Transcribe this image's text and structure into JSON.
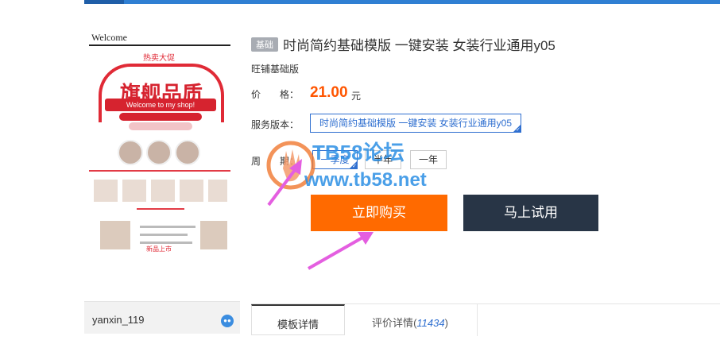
{
  "product": {
    "badge": "基础",
    "title": "时尚简约基础模版 一键安装 女装行业通用y05",
    "shop": "旺铺基础版",
    "price_label": "价　　格：",
    "price": "21.00",
    "currency": "元",
    "version_label": "服务版本：",
    "version_option": "时尚简约基础模版 一键安装 女装行业通用y05",
    "period_label": "周　　期：",
    "periods": [
      "一季度",
      "半年",
      "一年"
    ],
    "buy_label": "立即购买",
    "trial_label": "马上试用"
  },
  "thumbnail": {
    "welcome": "Welcome",
    "headline": "旗舰品质",
    "subline": "Welcome to my shop!",
    "promo": "热卖大促",
    "new_label": "新品上市"
  },
  "watermark": {
    "line1": "TB58论坛",
    "line2": "www.tb58.net"
  },
  "sidebar": {
    "username": "yanxin_119"
  },
  "tabs": [
    {
      "label": "模板详情"
    },
    {
      "label": "评价详情",
      "count": "11434"
    }
  ],
  "colors": {
    "accent": "#2f7fd3",
    "price": "#ff5500",
    "buy_button": "#ff6a00",
    "trial_button": "#283546"
  }
}
